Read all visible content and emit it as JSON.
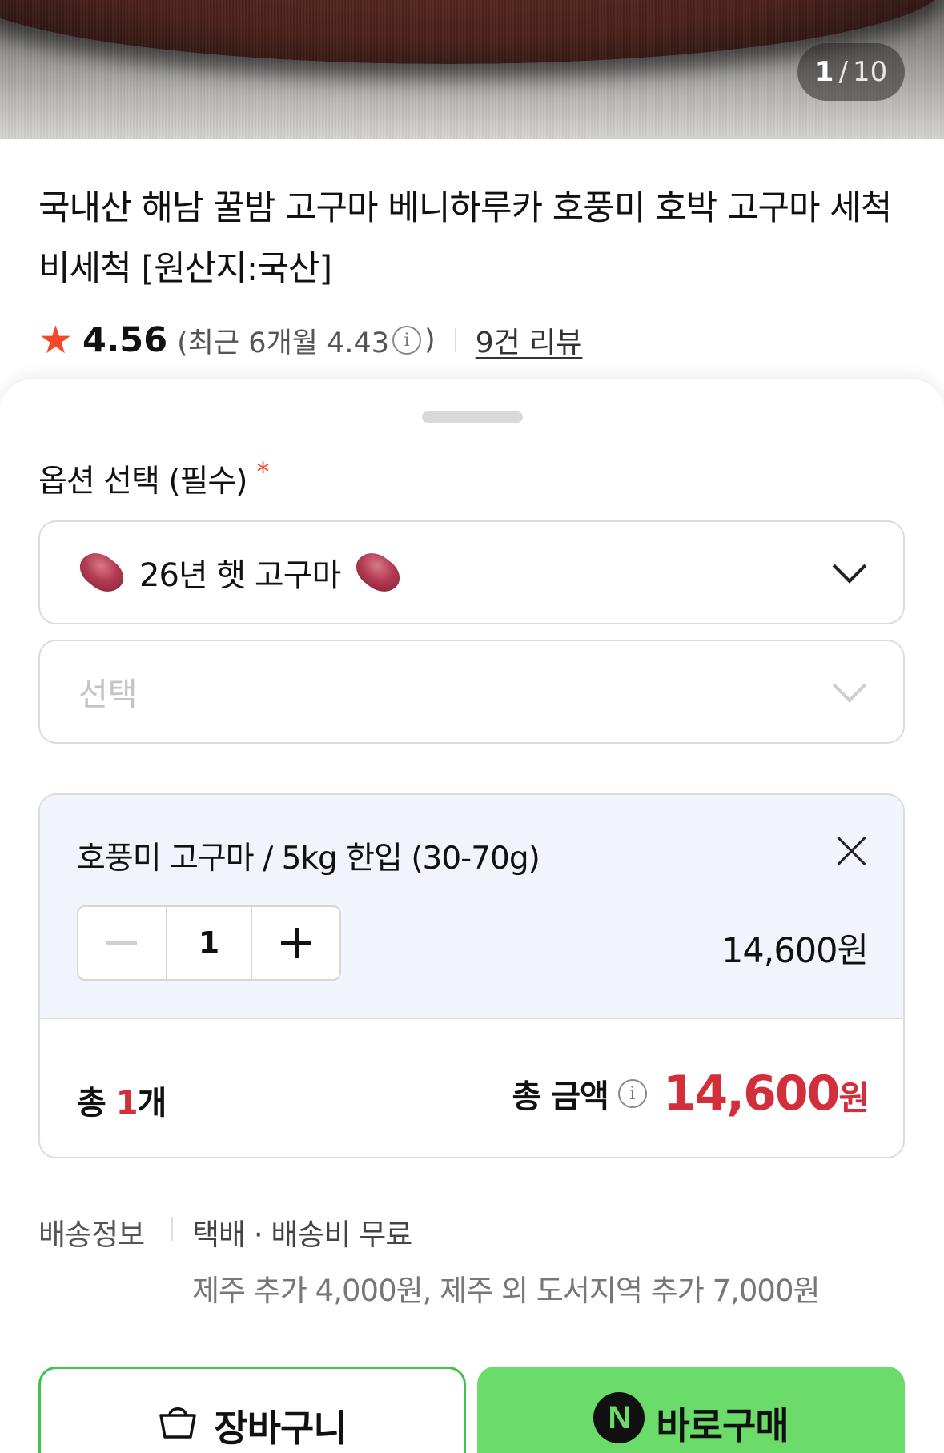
{
  "gallery": {
    "current": "1",
    "separator": "/",
    "total": "10"
  },
  "product": {
    "title": "국내산 해남 꿀밤 고구마 베니하루카 호풍미 호박 고구마 세척 비세척 [원산지:국산]"
  },
  "rating": {
    "star_icon": "star-icon",
    "score": "4.56",
    "recent_open": "(최근 6개월 4.43",
    "info_icon": "i",
    "recent_close": ")",
    "reviews_link": "9건 리뷰"
  },
  "options": {
    "label": "옵션 선택 (필수)",
    "required_mark": "*",
    "select1_value": "26년 햇 고구마",
    "select2_placeholder": "선택"
  },
  "selected_item": {
    "name": "호풍미 고구마 / 5kg 한입 (30-70g)",
    "quantity": "1",
    "price": "14,600원"
  },
  "total": {
    "qty_prefix": "총 ",
    "qty_num": "1",
    "qty_suffix": "개",
    "amount_label": "총 금액",
    "info_icon": "i",
    "amount": "14,600",
    "amount_unit": "원"
  },
  "shipping": {
    "label": "배송정보",
    "method": "택배 · 배송비 무료",
    "extra": "제주 추가 4,000원, 제주 외 도서지역 추가 7,000원"
  },
  "buttons": {
    "cart_label": "장바구니",
    "buy_logo": "N",
    "buy_label": "바로구매"
  },
  "colors": {
    "accent_red": "#d32f3a",
    "star": "#f2492a",
    "buy_green": "#6bdb6a",
    "cart_border": "#42c14c",
    "selected_bg": "#f1f4fa"
  }
}
